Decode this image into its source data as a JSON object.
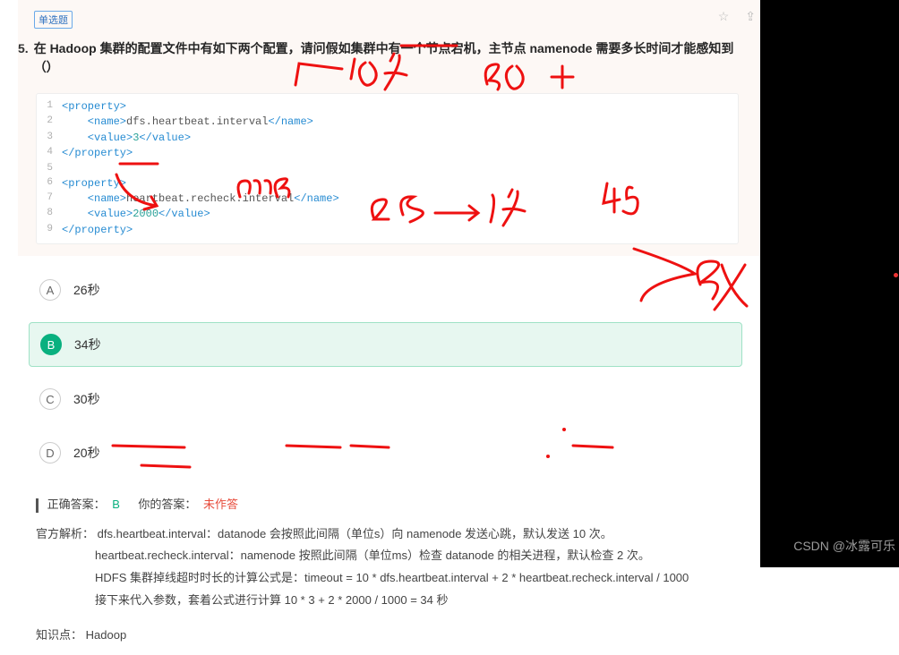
{
  "tag_label": "单选题",
  "question_number": "5.",
  "question_text": "在 Hadoop 集群的配置文件中有如下两个配置，请问假如集群中有一个节点宕机，主节点 namenode 需要多长时间才能感知到（）",
  "code": {
    "lines": [
      {
        "n": "1",
        "open": "<property>",
        "body": "",
        "close": ""
      },
      {
        "n": "2",
        "open": "    <name>",
        "body": "dfs.heartbeat.interval",
        "close": "</name>"
      },
      {
        "n": "3",
        "open": "    <value>",
        "body": "3",
        "close": "</value>"
      },
      {
        "n": "4",
        "open": "</property>",
        "body": "",
        "close": ""
      },
      {
        "n": "5",
        "open": "",
        "body": "",
        "close": ""
      },
      {
        "n": "6",
        "open": "<property>",
        "body": "",
        "close": ""
      },
      {
        "n": "7",
        "open": "    <name>",
        "body": "heartbeat.recheck.interval",
        "close": "</name>"
      },
      {
        "n": "8",
        "open": "    <value>",
        "body": "2000",
        "close": "</value>"
      },
      {
        "n": "9",
        "open": "</property>",
        "body": "",
        "close": ""
      }
    ]
  },
  "options": [
    {
      "letter": "A",
      "text": "26秒",
      "selected": false
    },
    {
      "letter": "B",
      "text": "34秒",
      "selected": true
    },
    {
      "letter": "C",
      "text": "30秒",
      "selected": false
    },
    {
      "letter": "D",
      "text": "20秒",
      "selected": false
    }
  ],
  "answer": {
    "label_correct": "正确答案：",
    "correct": "B",
    "label_user": "你的答案：",
    "user": "未作答"
  },
  "explanation": {
    "label": "官方解析：",
    "line1": "dfs.heartbeat.interval：datanode 会按照此间隔（单位s）向 namenode 发送心跳，默认发送 10 次。",
    "line2": "heartbeat.recheck.interval：namenode 按照此间隔（单位ms）检查 datanode 的相关进程，默认检查 2 次。",
    "line3": "HDFS 集群掉线超时时长的计算公式是：timeout = 10 * dfs.heartbeat.interval + 2 * heartbeat.recheck.interval / 1000",
    "line4": "接下来代入参数，套着公式进行计算 10 * 3 + 2 * 2000 / 1000 = 34 秒"
  },
  "knowledge_point": {
    "label": "知识点：",
    "value": "Hadoop"
  },
  "watermark": "CSDN @冰露可乐",
  "icons": {
    "star": "☆",
    "more": "⇪"
  }
}
